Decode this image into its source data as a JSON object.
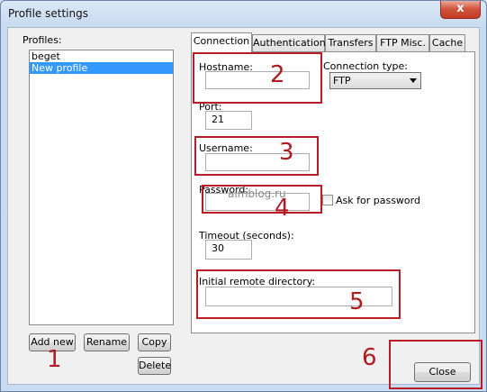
{
  "window": {
    "title": "Profile settings",
    "close_glyph": "x"
  },
  "profiles": {
    "label": "Profiles:",
    "items": [
      "beget",
      "New profile"
    ],
    "selected": "New profile"
  },
  "buttons": {
    "add_new": "Add new",
    "rename": "Rename",
    "copy": "Copy",
    "delete": "Delete",
    "close": "Close"
  },
  "tabs": [
    "Connection",
    "Authentication",
    "Transfers",
    "FTP Misc.",
    "Cache"
  ],
  "active_tab": "Connection",
  "connection": {
    "hostname_label": "Hostname:",
    "hostname_value": "",
    "connection_type_label": "Connection type:",
    "connection_type_value": "FTP",
    "port_label": "Port:",
    "port_value": "21",
    "username_label": "Username:",
    "username_value": "",
    "password_label": "Password:",
    "password_value": "",
    "ask_password_label": "Ask for password",
    "ask_password_checked": false,
    "timeout_label": "Timeout (seconds):",
    "timeout_value": "30",
    "remote_dir_label": "Initial remote directory:",
    "remote_dir_value": ""
  },
  "annotations": {
    "n1": "1",
    "n2": "2",
    "n3": "3",
    "n4": "4",
    "n5": "5",
    "n6": "6",
    "watermark": "aimblog.ru"
  },
  "colors": {
    "annotation_red": "#b81d25",
    "selection_blue": "#3399ff"
  }
}
